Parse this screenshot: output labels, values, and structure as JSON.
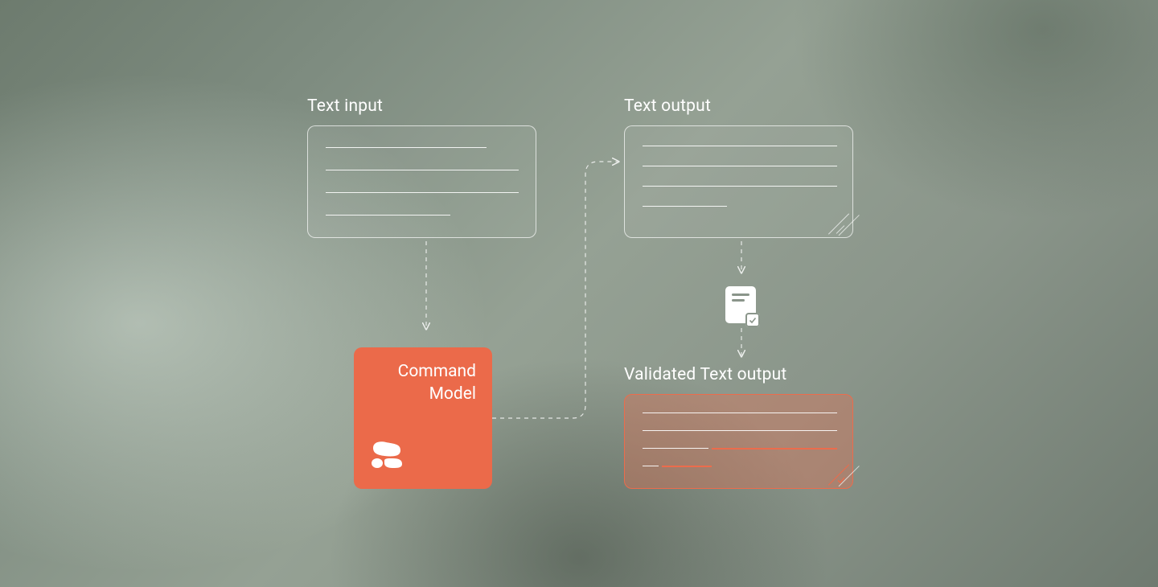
{
  "labels": {
    "text_input": "Text input",
    "text_output": "Text output",
    "validated_output": "Validated Text output"
  },
  "command_model": {
    "line1": "Command",
    "line2": "Model",
    "bg_color": "#eb6a4a"
  },
  "colors": {
    "accent_orange": "#ec6c4c",
    "white_line": "rgba(255,255,255,0.88)"
  },
  "flow": {
    "nodes": [
      {
        "id": "text-input",
        "type": "text-card"
      },
      {
        "id": "command-model",
        "type": "model"
      },
      {
        "id": "text-output",
        "type": "text-card"
      },
      {
        "id": "validator",
        "type": "document-check-icon"
      },
      {
        "id": "validated-text-output",
        "type": "validated-text-card"
      }
    ],
    "edges": [
      {
        "from": "text-input",
        "to": "command-model",
        "style": "dashed"
      },
      {
        "from": "command-model",
        "to": "text-output",
        "style": "dashed"
      },
      {
        "from": "text-output",
        "to": "validator",
        "style": "dashed"
      },
      {
        "from": "validator",
        "to": "validated-text-output",
        "style": "dashed"
      }
    ]
  }
}
